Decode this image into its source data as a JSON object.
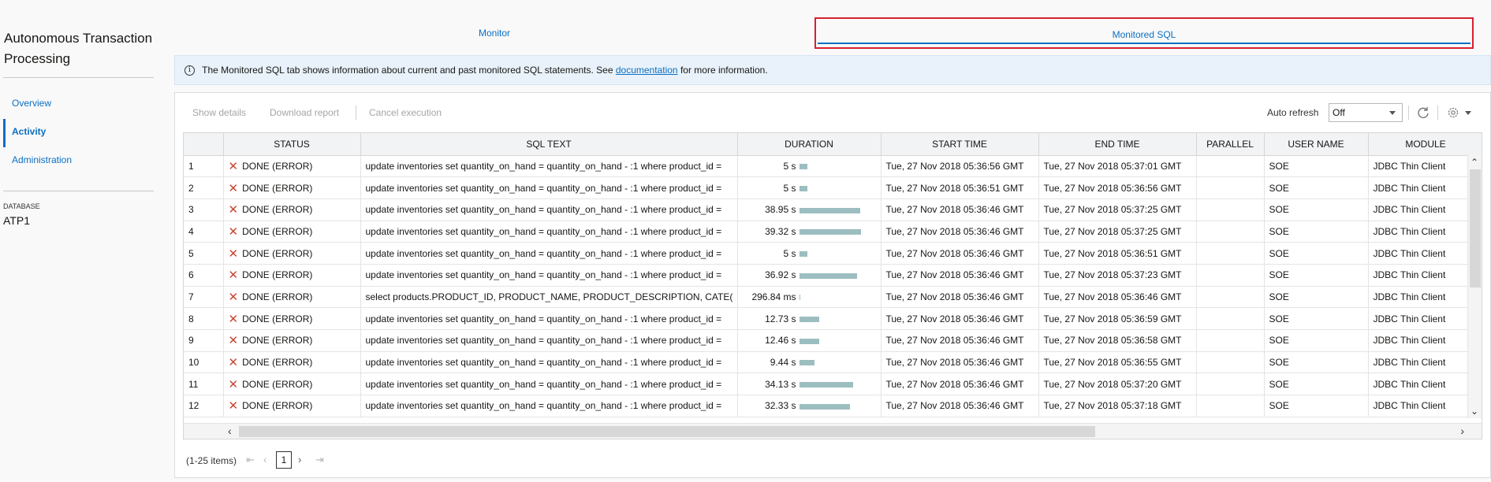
{
  "sidebar": {
    "app_title": "Autonomous Transaction Processing",
    "items": [
      {
        "label": "Overview",
        "active": false
      },
      {
        "label": "Activity",
        "active": true
      },
      {
        "label": "Administration",
        "active": false
      }
    ],
    "database_label": "DATABASE",
    "database_value": "ATP1"
  },
  "tabs": [
    {
      "label": "Monitor"
    },
    {
      "label": "Monitored SQL"
    }
  ],
  "banner": {
    "text_before": "The Monitored SQL tab shows information about current and past monitored SQL statements. See",
    "link": "documentation",
    "text_after": "for more information."
  },
  "toolbar": {
    "show_details": "Show details",
    "download_report": "Download report",
    "cancel_execution": "Cancel execution",
    "auto_refresh_label": "Auto refresh",
    "auto_refresh_value": "Off"
  },
  "table": {
    "columns": [
      "",
      "STATUS",
      "SQL TEXT",
      "DURATION",
      "START TIME",
      "END TIME",
      "PARALLEL",
      "USER NAME",
      "MODULE"
    ],
    "max_duration_s": 39.32,
    "rows": [
      {
        "n": "1",
        "status": "DONE (ERROR)",
        "sql": "update inventories set quantity_on_hand = quantity_on_hand - :1 where product_id =",
        "duration": "5 s",
        "seconds": 5,
        "start": "Tue, 27 Nov 2018 05:36:56 GMT",
        "end": "Tue, 27 Nov 2018 05:37:01 GMT",
        "parallel": "",
        "user": "SOE",
        "module": "JDBC Thin Client"
      },
      {
        "n": "2",
        "status": "DONE (ERROR)",
        "sql": "update inventories set quantity_on_hand = quantity_on_hand - :1 where product_id =",
        "duration": "5 s",
        "seconds": 5,
        "start": "Tue, 27 Nov 2018 05:36:51 GMT",
        "end": "Tue, 27 Nov 2018 05:36:56 GMT",
        "parallel": "",
        "user": "SOE",
        "module": "JDBC Thin Client"
      },
      {
        "n": "3",
        "status": "DONE (ERROR)",
        "sql": "update inventories set quantity_on_hand = quantity_on_hand - :1 where product_id =",
        "duration": "38.95 s",
        "seconds": 38.95,
        "start": "Tue, 27 Nov 2018 05:36:46 GMT",
        "end": "Tue, 27 Nov 2018 05:37:25 GMT",
        "parallel": "",
        "user": "SOE",
        "module": "JDBC Thin Client"
      },
      {
        "n": "4",
        "status": "DONE (ERROR)",
        "sql": "update inventories set quantity_on_hand = quantity_on_hand - :1 where product_id =",
        "duration": "39.32 s",
        "seconds": 39.32,
        "start": "Tue, 27 Nov 2018 05:36:46 GMT",
        "end": "Tue, 27 Nov 2018 05:37:25 GMT",
        "parallel": "",
        "user": "SOE",
        "module": "JDBC Thin Client"
      },
      {
        "n": "5",
        "status": "DONE (ERROR)",
        "sql": "update inventories set quantity_on_hand = quantity_on_hand - :1 where product_id =",
        "duration": "5 s",
        "seconds": 5,
        "start": "Tue, 27 Nov 2018 05:36:46 GMT",
        "end": "Tue, 27 Nov 2018 05:36:51 GMT",
        "parallel": "",
        "user": "SOE",
        "module": "JDBC Thin Client"
      },
      {
        "n": "6",
        "status": "DONE (ERROR)",
        "sql": "update inventories set quantity_on_hand = quantity_on_hand - :1 where product_id =",
        "duration": "36.92 s",
        "seconds": 36.92,
        "start": "Tue, 27 Nov 2018 05:36:46 GMT",
        "end": "Tue, 27 Nov 2018 05:37:23 GMT",
        "parallel": "",
        "user": "SOE",
        "module": "JDBC Thin Client"
      },
      {
        "n": "7",
        "status": "DONE (ERROR)",
        "sql": "select products.PRODUCT_ID, PRODUCT_NAME, PRODUCT_DESCRIPTION, CATE(",
        "duration": "296.84 ms",
        "seconds": 0.29684,
        "start": "Tue, 27 Nov 2018 05:36:46 GMT",
        "end": "Tue, 27 Nov 2018 05:36:46 GMT",
        "parallel": "",
        "user": "SOE",
        "module": "JDBC Thin Client"
      },
      {
        "n": "8",
        "status": "DONE (ERROR)",
        "sql": "update inventories set quantity_on_hand = quantity_on_hand - :1 where product_id =",
        "duration": "12.73 s",
        "seconds": 12.73,
        "start": "Tue, 27 Nov 2018 05:36:46 GMT",
        "end": "Tue, 27 Nov 2018 05:36:59 GMT",
        "parallel": "",
        "user": "SOE",
        "module": "JDBC Thin Client"
      },
      {
        "n": "9",
        "status": "DONE (ERROR)",
        "sql": "update inventories set quantity_on_hand = quantity_on_hand - :1 where product_id =",
        "duration": "12.46 s",
        "seconds": 12.46,
        "start": "Tue, 27 Nov 2018 05:36:46 GMT",
        "end": "Tue, 27 Nov 2018 05:36:58 GMT",
        "parallel": "",
        "user": "SOE",
        "module": "JDBC Thin Client"
      },
      {
        "n": "10",
        "status": "DONE (ERROR)",
        "sql": "update inventories set quantity_on_hand = quantity_on_hand - :1 where product_id =",
        "duration": "9.44 s",
        "seconds": 9.44,
        "start": "Tue, 27 Nov 2018 05:36:46 GMT",
        "end": "Tue, 27 Nov 2018 05:36:55 GMT",
        "parallel": "",
        "user": "SOE",
        "module": "JDBC Thin Client"
      },
      {
        "n": "11",
        "status": "DONE (ERROR)",
        "sql": "update inventories set quantity_on_hand = quantity_on_hand - :1 where product_id =",
        "duration": "34.13 s",
        "seconds": 34.13,
        "start": "Tue, 27 Nov 2018 05:36:46 GMT",
        "end": "Tue, 27 Nov 2018 05:37:20 GMT",
        "parallel": "",
        "user": "SOE",
        "module": "JDBC Thin Client"
      },
      {
        "n": "12",
        "status": "DONE (ERROR)",
        "sql": "update inventories set quantity_on_hand = quantity_on_hand - :1 where product_id =",
        "duration": "32.33 s",
        "seconds": 32.33,
        "start": "Tue, 27 Nov 2018 05:36:46 GMT",
        "end": "Tue, 27 Nov 2018 05:37:18 GMT",
        "parallel": "",
        "user": "SOE",
        "module": "JDBC Thin Client"
      }
    ]
  },
  "pager": {
    "count": "(1-25 items)",
    "current_page": "1"
  },
  "colors": {
    "accent": "#0b6fc2",
    "highlight_border": "#d8202f",
    "error_icon": "#c74634",
    "duration_bar": "#9dbec0"
  }
}
